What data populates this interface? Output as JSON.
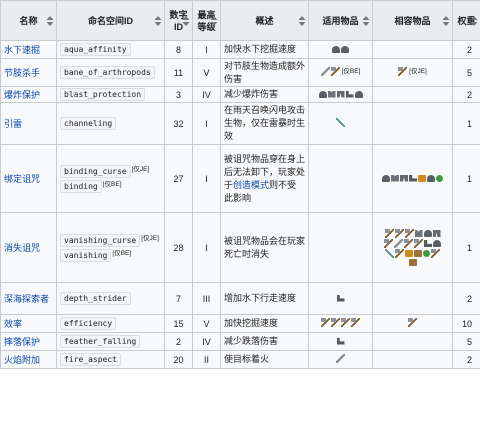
{
  "headers": [
    "名称",
    "命名空间ID",
    "数字ID",
    "最高等级",
    "概述",
    "适用物品",
    "相容物品",
    "权重"
  ],
  "rows": [
    {
      "name": "水下速掘",
      "ids": [
        {
          "code": "aqua_affinity",
          "tag": ""
        }
      ],
      "num": "8",
      "max": "I",
      "desc": "加快水下挖掘速度",
      "desc_link": "",
      "desc_after": "",
      "applicable": [
        "helmet",
        "helmet"
      ],
      "app_tag": "",
      "compatible": [],
      "comp_tag": "",
      "weight": "2"
    },
    {
      "name": "节肢杀手",
      "ids": [
        {
          "code": "bane_of_arthropods",
          "tag": ""
        }
      ],
      "num": "11",
      "max": "V",
      "desc": "对节肢生物造成额外伤害",
      "desc_link": "",
      "desc_after": "",
      "applicable": [
        "sword",
        "tool"
      ],
      "app_tag": "[仅BE]",
      "compatible": [
        "tool"
      ],
      "comp_tag": "[仅JE]",
      "weight": "5"
    },
    {
      "name": "爆炸保护",
      "ids": [
        {
          "code": "blast_protection",
          "tag": ""
        }
      ],
      "num": "3",
      "max": "IV",
      "desc": "减少爆炸伤害",
      "desc_link": "",
      "desc_after": "",
      "applicable": [
        "helmet",
        "chest",
        "legs",
        "boots",
        "helmet"
      ],
      "app_tag": "",
      "compatible": [],
      "comp_tag": "",
      "weight": "2"
    },
    {
      "name": "引雷",
      "ids": [
        {
          "code": "channeling",
          "tag": ""
        }
      ],
      "num": "32",
      "max": "I",
      "desc": "在雨天召唤闪电攻击生物，仅在雷暴时生效",
      "desc_link": "",
      "desc_after": "",
      "applicable": [
        "trident"
      ],
      "app_tag": "",
      "compatible": [],
      "comp_tag": "",
      "weight": "1"
    },
    {
      "name": "绑定诅咒",
      "ids": [
        {
          "code": "binding_curse",
          "tag": "[仅JE]"
        },
        {
          "code": "binding",
          "tag": "[仅BE]"
        }
      ],
      "num": "27",
      "max": "I",
      "desc": "被诅咒物品穿在身上后无法卸下，玩家处于",
      "desc_link": "创造模式",
      "desc_after": "则不受此影响",
      "applicable": [],
      "app_tag": "",
      "compatible": [
        "helmet",
        "chest",
        "legs",
        "boots",
        "pump",
        "helmet",
        "green"
      ],
      "comp_tag": "",
      "weight": "1"
    },
    {
      "name": "消失诅咒",
      "ids": [
        {
          "code": "vanishing_curse",
          "tag": "[仅JE]"
        },
        {
          "code": "vanishing",
          "tag": "[仅BE]"
        }
      ],
      "num": "28",
      "max": "I",
      "desc": "被诅咒物品会在玩家死亡时消失",
      "desc_link": "",
      "desc_after": "",
      "applicable": [],
      "app_tag": "",
      "compatible": [
        "tool",
        "tool",
        "tool",
        "chest",
        "helmet",
        "legs",
        "tool",
        "sword",
        "tool",
        "tool",
        "boots",
        "helmet",
        "trident",
        "tool",
        "pump",
        "head",
        "green",
        "tool",
        "head"
      ],
      "comp_tag": "",
      "weight": "1"
    },
    {
      "name": "深海探索者",
      "ids": [
        {
          "code": "depth_strider",
          "tag": ""
        }
      ],
      "num": "7",
      "max": "III",
      "desc": "增加水下行走速度",
      "desc_link": "",
      "desc_after": "",
      "applicable": [
        "boots"
      ],
      "app_tag": "",
      "compatible": [],
      "comp_tag": "",
      "weight": "2"
    },
    {
      "name": "效率",
      "ids": [
        {
          "code": "efficiency",
          "tag": ""
        }
      ],
      "num": "15",
      "max": "V",
      "desc": "加快挖掘速度",
      "desc_link": "",
      "desc_after": "",
      "applicable": [
        "tool",
        "tool",
        "tool",
        "tool"
      ],
      "app_tag": "",
      "compatible": [
        "tool"
      ],
      "comp_tag": "",
      "weight": "10"
    },
    {
      "name": "摔落保护",
      "ids": [
        {
          "code": "feather_falling",
          "tag": ""
        }
      ],
      "num": "2",
      "max": "IV",
      "desc": "减少跌落伤害",
      "desc_link": "",
      "desc_after": "",
      "applicable": [
        "boots"
      ],
      "app_tag": "",
      "compatible": [],
      "comp_tag": "",
      "weight": "5"
    },
    {
      "name": "火焰附加",
      "ids": [
        {
          "code": "fire_aspect",
          "tag": ""
        }
      ],
      "num": "20",
      "max": "II",
      "desc": "使目标着火",
      "desc_link": "",
      "desc_after": "",
      "applicable": [
        "sword"
      ],
      "app_tag": "",
      "compatible": [],
      "comp_tag": "",
      "weight": "2"
    }
  ]
}
